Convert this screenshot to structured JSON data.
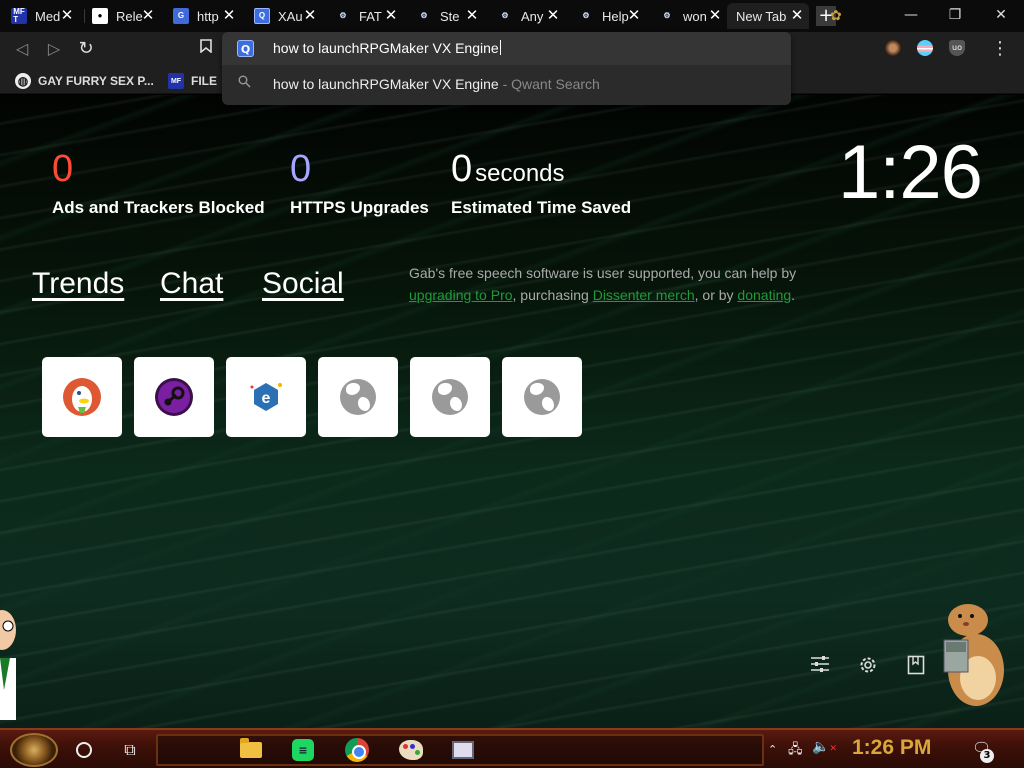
{
  "tabs": [
    {
      "title": "Med",
      "favicon": "mft-icon",
      "favicon_text": "MF T"
    },
    {
      "title": "Rele",
      "favicon": "github-icon",
      "favicon_text": "●"
    },
    {
      "title": "http",
      "favicon": "translate-icon",
      "favicon_text": "G"
    },
    {
      "title": "XAu",
      "favicon": "qwant-icon",
      "favicon_text": "Q"
    },
    {
      "title": "FAT",
      "favicon": "steam-icon",
      "favicon_text": "⚙"
    },
    {
      "title": "Ste",
      "favicon": "steam-icon",
      "favicon_text": "⚙"
    },
    {
      "title": "Any",
      "favicon": "steam-icon",
      "favicon_text": "⚙"
    },
    {
      "title": "Help",
      "favicon": "steam-icon",
      "favicon_text": "⚙"
    },
    {
      "title": "won",
      "favicon": "steam-icon",
      "favicon_text": "⚙"
    },
    {
      "title": "New Tab",
      "favicon": "",
      "favicon_text": ""
    }
  ],
  "tab_close_glyph": "✕",
  "new_tab_glyph": "+",
  "window_controls": {
    "minimize": "—",
    "restore": "❐",
    "close": "✕"
  },
  "toolbar": {
    "back": "◁",
    "forward": "▷",
    "reload": "↻",
    "bookmark": "🔖",
    "menu": "⋮"
  },
  "omnibox": {
    "engine_icon": "Q",
    "input_value": "how to launchRPGMaker VX Engine",
    "suggestion_icon": "⚲",
    "suggestion_query": "how to launchRPGMaker VX Engine",
    "suggestion_engine": " - Qwant Search"
  },
  "bookmarks": [
    {
      "label": "GAY FURRY SEX P...",
      "icon": "globe-icon",
      "glyph": "◍"
    },
    {
      "label": "FILE",
      "icon": "mft-icon",
      "glyph": "M"
    }
  ],
  "stats": {
    "ads_value": "0",
    "ads_label": "Ads and Trackers Blocked",
    "https_value": "0",
    "https_label": "HTTPS Upgrades",
    "time_value": "0",
    "time_unit": "seconds",
    "time_label": "Estimated Time Saved"
  },
  "clock": "1:26",
  "nav": {
    "trends": "Trends",
    "chat": "Chat",
    "social": "Social"
  },
  "gab": {
    "text1": "Gab's free speech software is user supported, you can help by ",
    "link_pro": "upgrading to Pro",
    "text2": ", purchasing ",
    "link_merch": "Dissenter merch",
    "text3": ", or by ",
    "link_donate": "donating",
    "text4": "."
  },
  "tiles": [
    {
      "name": "duckduckgo-tile",
      "icon": "duckduckgo-icon"
    },
    {
      "name": "steam-tile",
      "icon": "steam-icon"
    },
    {
      "name": "edge-tile",
      "icon": "edge-icon",
      "glyph": "e"
    },
    {
      "name": "site-tile-1",
      "icon": "globe-icon"
    },
    {
      "name": "site-tile-2",
      "icon": "globe-icon"
    },
    {
      "name": "site-tile-3",
      "icon": "globe-icon"
    }
  ],
  "ntp_controls": {
    "customize": "⚟",
    "settings": "⚙",
    "bookmarks": "▣"
  },
  "taskbar": {
    "clock": "1:26 PM",
    "notification_count": "3",
    "task_view_glyph": "⧉",
    "tray_arrow": "⌃",
    "network_glyph": "🖧",
    "volume_glyph": "🔈",
    "volume_mute": "✕",
    "notif_glyph": "🗨"
  }
}
